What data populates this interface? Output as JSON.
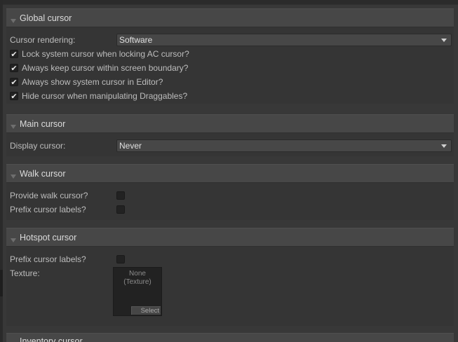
{
  "global_cursor": {
    "title": "Global cursor",
    "rendering_label": "Cursor rendering:",
    "rendering_value": "Software",
    "options": [
      {
        "label": "Lock system cursor when locking AC cursor?",
        "checked": true
      },
      {
        "label": "Always keep cursor within screen boundary?",
        "checked": true
      },
      {
        "label": "Always show system cursor in Editor?",
        "checked": true
      },
      {
        "label": "Hide cursor when manipulating Draggables?",
        "checked": true
      }
    ]
  },
  "main_cursor": {
    "title": "Main cursor",
    "display_label": "Display cursor:",
    "display_value": "Never"
  },
  "walk_cursor": {
    "title": "Walk cursor",
    "provide_label": "Provide walk cursor?",
    "provide_checked": false,
    "prefix_label": "Prefix cursor labels?",
    "prefix_checked": false
  },
  "hotspot_cursor": {
    "title": "Hotspot cursor",
    "prefix_label": "Prefix cursor labels?",
    "prefix_checked": false,
    "texture_label": "Texture:",
    "texture_line1": "None",
    "texture_line2": "(Texture)",
    "select_label": "Select"
  },
  "inventory_cursor": {
    "title": "Inventory cursor"
  },
  "check_mark": "✔"
}
